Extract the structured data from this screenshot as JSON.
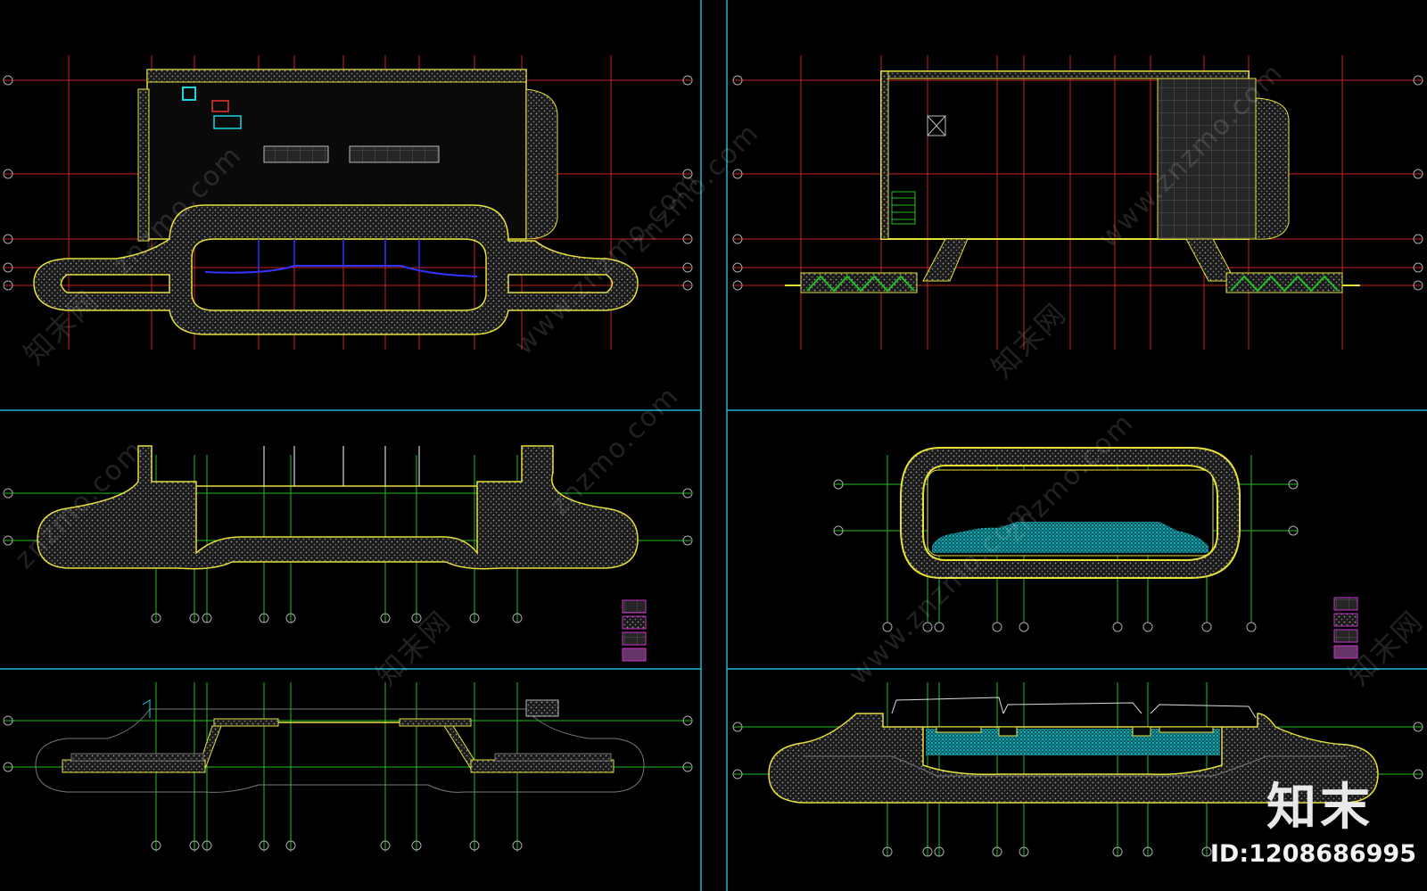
{
  "watermark": {
    "site": "znzmo.com",
    "site_spaced": "www.znzmo.com",
    "brand_cn": "知末网"
  },
  "logo": {
    "text": "知末"
  },
  "id_label": {
    "text": "ID:1208686995"
  },
  "colors": {
    "background": "#000000",
    "grid": "#cc2222",
    "frame": "#1fb5c9",
    "wall": "#e6e03c",
    "hatch": "#9a9a9a",
    "axis": "#22c022",
    "water": "#19d6e0",
    "accent": "#cc33cc"
  }
}
